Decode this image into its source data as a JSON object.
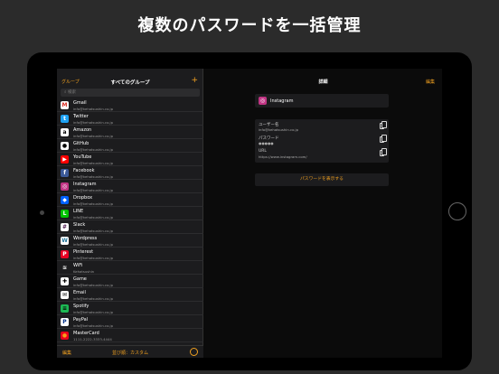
{
  "headline": "複数のパスワードを一括管理",
  "status": {
    "left": "iPad ᯤ",
    "time": "7:41",
    "right": "☾ ✱ 63% ▭"
  },
  "sidebar": {
    "back_label": "グループ",
    "title": "すべてのグループ",
    "add_label": "+",
    "search_placeholder": "検索",
    "items": [
      {
        "name": "Gmail",
        "sub": "info@kehatsushin.co.jp",
        "color": "#ffffff",
        "fg": "#d93025",
        "glyph": "M"
      },
      {
        "name": "Twitter",
        "sub": "info@kehatsushin.co.jp",
        "color": "#1da1f2",
        "fg": "#ffffff",
        "glyph": "t"
      },
      {
        "name": "Amazon",
        "sub": "info@kehatsushin.co.jp",
        "color": "#ffffff",
        "fg": "#000000",
        "glyph": "a"
      },
      {
        "name": "GitHub",
        "sub": "info@kehatsushin.co.jp",
        "color": "#ffffff",
        "fg": "#000000",
        "glyph": "●"
      },
      {
        "name": "YouTube",
        "sub": "info@kehatsushin.co.jp",
        "color": "#ff0000",
        "fg": "#ffffff",
        "glyph": "▶"
      },
      {
        "name": "Facebook",
        "sub": "info@kehatsushin.co.jp",
        "color": "#3b5998",
        "fg": "#ffffff",
        "glyph": "f"
      },
      {
        "name": "Instagram",
        "sub": "info@kehatsushin.co.jp",
        "color": "#c13584",
        "fg": "#ffffff",
        "glyph": "◎"
      },
      {
        "name": "Dropbox",
        "sub": "info@kehatsushin.co.jp",
        "color": "#0061ff",
        "fg": "#ffffff",
        "glyph": "◆"
      },
      {
        "name": "LINE",
        "sub": "info@kehatsushin.co.jp",
        "color": "#00c300",
        "fg": "#ffffff",
        "glyph": "L"
      },
      {
        "name": "Slack",
        "sub": "info@kehatsushin.co.jp",
        "color": "#ffffff",
        "fg": "#4a154b",
        "glyph": "#"
      },
      {
        "name": "Wordpress",
        "sub": "info@kehatsushin.co.jp",
        "color": "#ffffff",
        "fg": "#21759b",
        "glyph": "W"
      },
      {
        "name": "Pinterest",
        "sub": "info@kehatsushin.co.jp",
        "color": "#e60023",
        "fg": "#ffffff",
        "glyph": "P"
      },
      {
        "name": "WiFi",
        "sub": "Kehatsushin",
        "color": "#1c1c1e",
        "fg": "#ffffff",
        "glyph": "≋"
      },
      {
        "name": "Game",
        "sub": "info@kehatsushin.co.jp",
        "color": "#ffffff",
        "fg": "#000000",
        "glyph": "✚"
      },
      {
        "name": "Email",
        "sub": "info@kehatsushin.co.jp",
        "color": "#ffffff",
        "fg": "#000000",
        "glyph": "✉"
      },
      {
        "name": "Spotify",
        "sub": "info@kehatsushin.co.jp",
        "color": "#1db954",
        "fg": "#000000",
        "glyph": "≡"
      },
      {
        "name": "PayPal",
        "sub": "info@kehatsushin.co.jp",
        "color": "#ffffff",
        "fg": "#003087",
        "glyph": "P"
      },
      {
        "name": "MasterCard",
        "sub": "1111-2222-3333-4444",
        "color": "#eb001b",
        "fg": "#f79e1b",
        "glyph": "●"
      }
    ],
    "toolbar": {
      "edit": "編集",
      "sort": "並び順：カスタム"
    }
  },
  "detail": {
    "title": "詳細",
    "edit_label": "編集",
    "app_name": "Instagram",
    "fields": [
      {
        "label": "ユーザー名",
        "value": "info@kehatsushin.co.jp"
      },
      {
        "label": "パスワード",
        "value": "●●●●●"
      },
      {
        "label": "URL",
        "value": "https://www.instagram.com/"
      }
    ],
    "show_password_button": "パスワードを表示する"
  }
}
